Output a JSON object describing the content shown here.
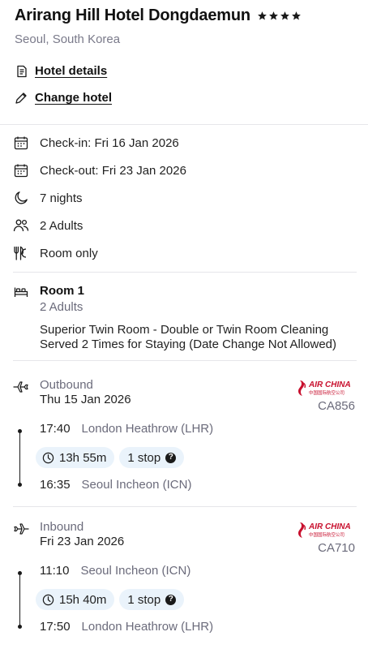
{
  "hotel": {
    "name": "Arirang Hill Hotel Dongdaemun",
    "star_count": 4,
    "location": "Seoul, South Korea",
    "details_link": "Hotel details",
    "change_link": "Change hotel"
  },
  "stay": {
    "check_in": "Check-in: Fri 16 Jan 2026",
    "check_out": "Check-out: Fri 23 Jan 2026",
    "nights": "7 nights",
    "guests": "2 Adults",
    "board": "Room only"
  },
  "room": {
    "title": "Room 1",
    "guests": "2 Adults",
    "description": "Superior Twin Room - Double or Twin Room Cleaning Served 2 Times for Staying (Date Change Not Allowed)"
  },
  "outbound": {
    "label": "Outbound",
    "date": "Thu 15 Jan 2026",
    "airline": "AIR CHINA",
    "airline_sub": "中国国际航空公司",
    "flight_no": "CA856",
    "dep_time": "17:40",
    "dep_airport": "London Heathrow (LHR)",
    "duration": "13h 55m",
    "stops": "1 stop",
    "arr_time": "16:35",
    "arr_airport": "Seoul Incheon (ICN)"
  },
  "inbound": {
    "label": "Inbound",
    "date": "Fri 23 Jan 2026",
    "airline": "AIR CHINA",
    "airline_sub": "中国国际航空公司",
    "flight_no": "CA710",
    "dep_time": "11:10",
    "dep_airport": "Seoul Incheon (ICN)",
    "duration": "15h 40m",
    "stops": "1 stop",
    "arr_time": "17:50",
    "arr_airport": "London Heathrow (LHR)"
  },
  "colors": {
    "airline_red": "#c8102e",
    "chip_bg": "#eaf3fb",
    "muted_text": "#6b6b7b"
  }
}
